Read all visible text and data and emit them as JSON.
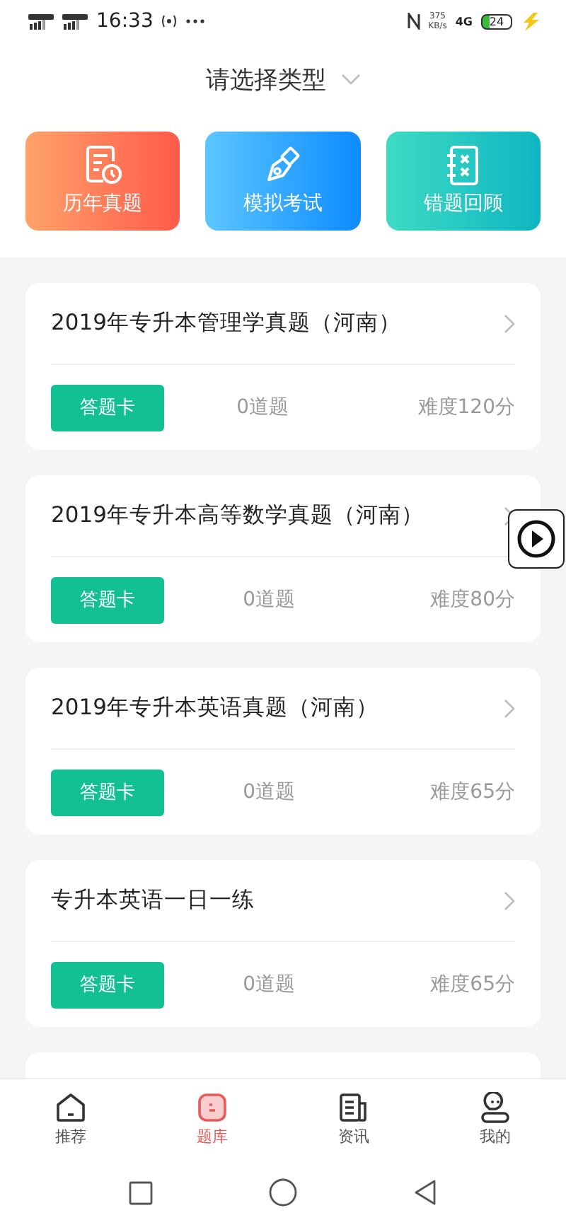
{
  "status_bar": {
    "time": "16:33",
    "net_speed": "375",
    "net_unit": "KB/s",
    "network": "4G",
    "battery": "24"
  },
  "header": {
    "title": "请选择类型"
  },
  "categories": [
    {
      "label": "历年真题",
      "kind": "history"
    },
    {
      "label": "模拟考试",
      "kind": "mock"
    },
    {
      "label": "错题回顾",
      "kind": "mistakes"
    }
  ],
  "exams": [
    {
      "title": "2019年专升本管理学真题（河南）",
      "button": "答题卡",
      "count": "0道题",
      "difficulty": "难度120分"
    },
    {
      "title": "2019年专升本高等数学真题（河南）",
      "button": "答题卡",
      "count": "0道题",
      "difficulty": "难度80分"
    },
    {
      "title": "2019年专升本英语真题（河南）",
      "button": "答题卡",
      "count": "0道题",
      "difficulty": "难度65分"
    },
    {
      "title": "专升本英语一日一练",
      "button": "答题卡",
      "count": "0道题",
      "difficulty": "难度65分"
    }
  ],
  "tabs": [
    {
      "label": "推荐",
      "kind": "home",
      "selected": false
    },
    {
      "label": "题库",
      "kind": "bank",
      "selected": true
    },
    {
      "label": "资讯",
      "kind": "news",
      "selected": false
    },
    {
      "label": "我的",
      "kind": "profile",
      "selected": false
    }
  ]
}
